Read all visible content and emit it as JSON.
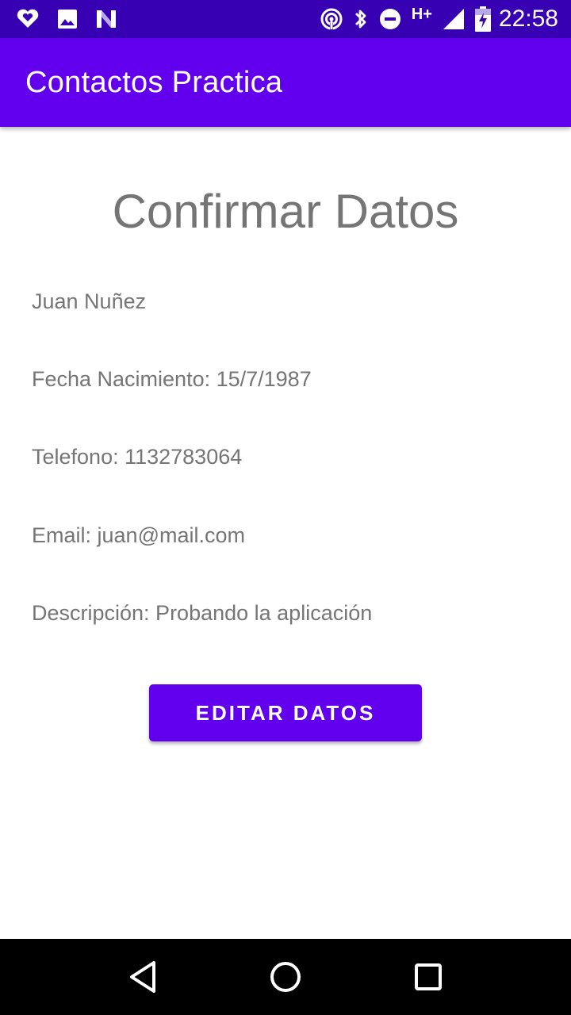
{
  "status_bar": {
    "time": "22:58",
    "network": "H+",
    "icons": [
      "heart-icon",
      "image-icon",
      "n-icon",
      "hotspot-icon",
      "bluetooth-icon",
      "do-not-disturb-icon",
      "signal-icon",
      "battery-charging-icon"
    ]
  },
  "app_bar": {
    "title": "Contactos Practica",
    "color": "#6200ee"
  },
  "main": {
    "heading": "Confirmar Datos",
    "name": "Juan Nuñez",
    "birth_date": "Fecha Nacimiento: 15/7/1987",
    "phone": "Telefono: 1132783064",
    "email": "Email: juan@mail.com",
    "description": "Descripción: Probando la aplicación",
    "edit_button_label": "EDITAR DATOS"
  },
  "nav_bar": {
    "icons": [
      "back-icon",
      "home-icon",
      "recents-icon"
    ]
  }
}
